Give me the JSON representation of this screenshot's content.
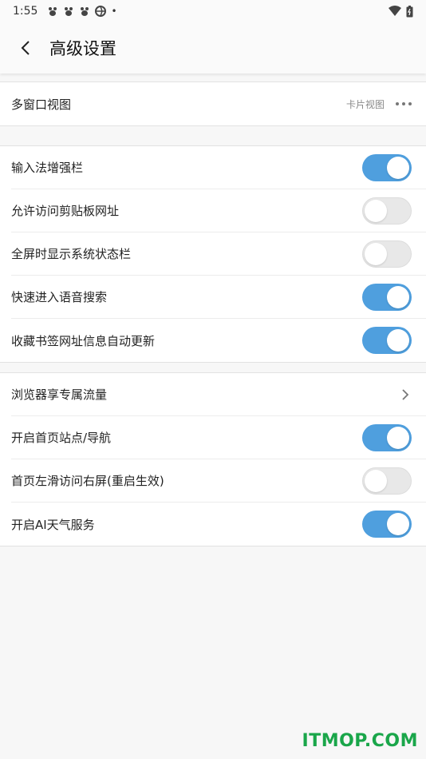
{
  "statusbar": {
    "time": "1:55",
    "dot": "•"
  },
  "header": {
    "title": "高级设置"
  },
  "sections": [
    {
      "items": [
        {
          "label": "多窗口视图",
          "value": "卡片视图",
          "control": "more"
        }
      ]
    },
    {
      "items": [
        {
          "label": "输入法增强栏",
          "control": "toggle",
          "on": true
        },
        {
          "label": "允许访问剪贴板网址",
          "control": "toggle",
          "on": false
        },
        {
          "label": "全屏时显示系统状态栏",
          "control": "toggle",
          "on": false
        },
        {
          "label": "快速进入语音搜索",
          "control": "toggle",
          "on": true
        },
        {
          "label": "收藏书签网址信息自动更新",
          "control": "toggle",
          "on": true
        }
      ]
    },
    {
      "items": [
        {
          "label": "浏览器享专属流量",
          "control": "chevron"
        },
        {
          "label": "开启首页站点/导航",
          "control": "toggle",
          "on": true
        },
        {
          "label": "首页左滑访问右屏(重启生效)",
          "control": "toggle",
          "on": false
        },
        {
          "label": "开启AI天气服务",
          "control": "toggle",
          "on": true
        }
      ]
    }
  ],
  "watermark": "ITMOP.COM",
  "colors": {
    "accent": "#4f9fde",
    "watermark": "#1aa64a"
  }
}
